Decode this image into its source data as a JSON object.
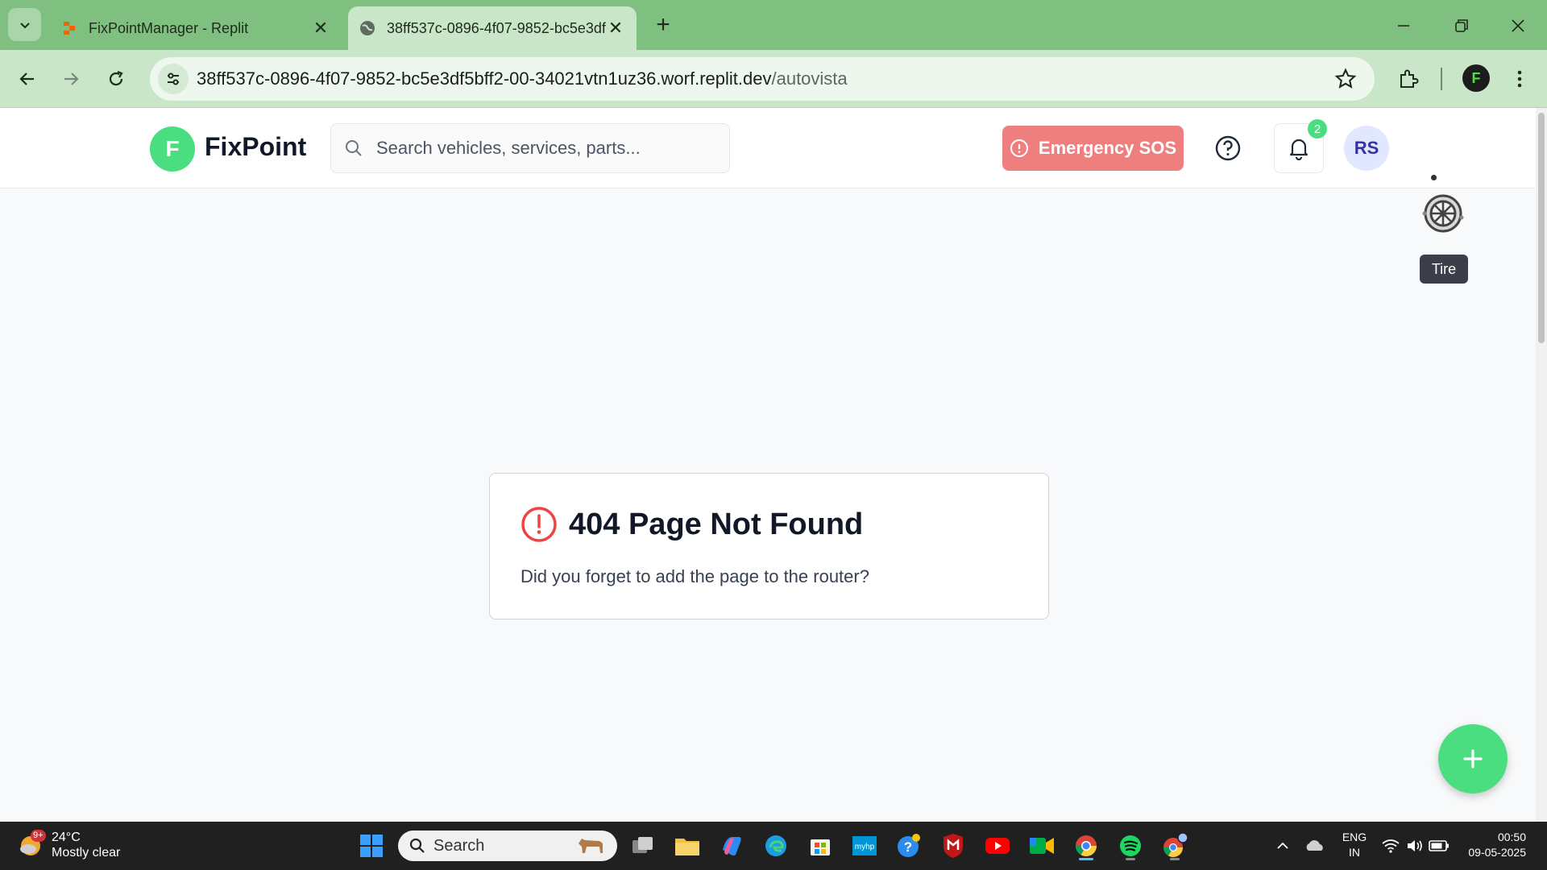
{
  "browser": {
    "tabs": [
      {
        "title": "FixPointManager - Replit",
        "active": false
      },
      {
        "title": "38ff537c-0896-4f07-9852-bc5e3df",
        "active": true
      }
    ],
    "url": {
      "host": "38ff537c-0896-4f07-9852-bc5e3df5bff2-00-34021vtn1uz36.worf.replit.dev",
      "path": "/autovista"
    },
    "profile_initial": "F"
  },
  "app": {
    "logo_letter": "F",
    "brand": "FixPoint",
    "search_placeholder": "Search vehicles, services, parts...",
    "sos_label": "Emergency SOS",
    "notification_count": "2",
    "avatar_initials": "RS",
    "tire_tooltip": "Tire",
    "accent_color": "#4ade80",
    "sos_color": "#ef7f7f"
  },
  "error_card": {
    "title": "404 Page Not Found",
    "message": "Did you forget to add the page to the router?"
  },
  "taskbar": {
    "weather_badge": "9+",
    "temperature": "24°C",
    "condition": "Mostly clear",
    "search_label": "Search",
    "language": "ENG",
    "region": "IN",
    "time": "00:50",
    "date": "09-05-2025"
  }
}
